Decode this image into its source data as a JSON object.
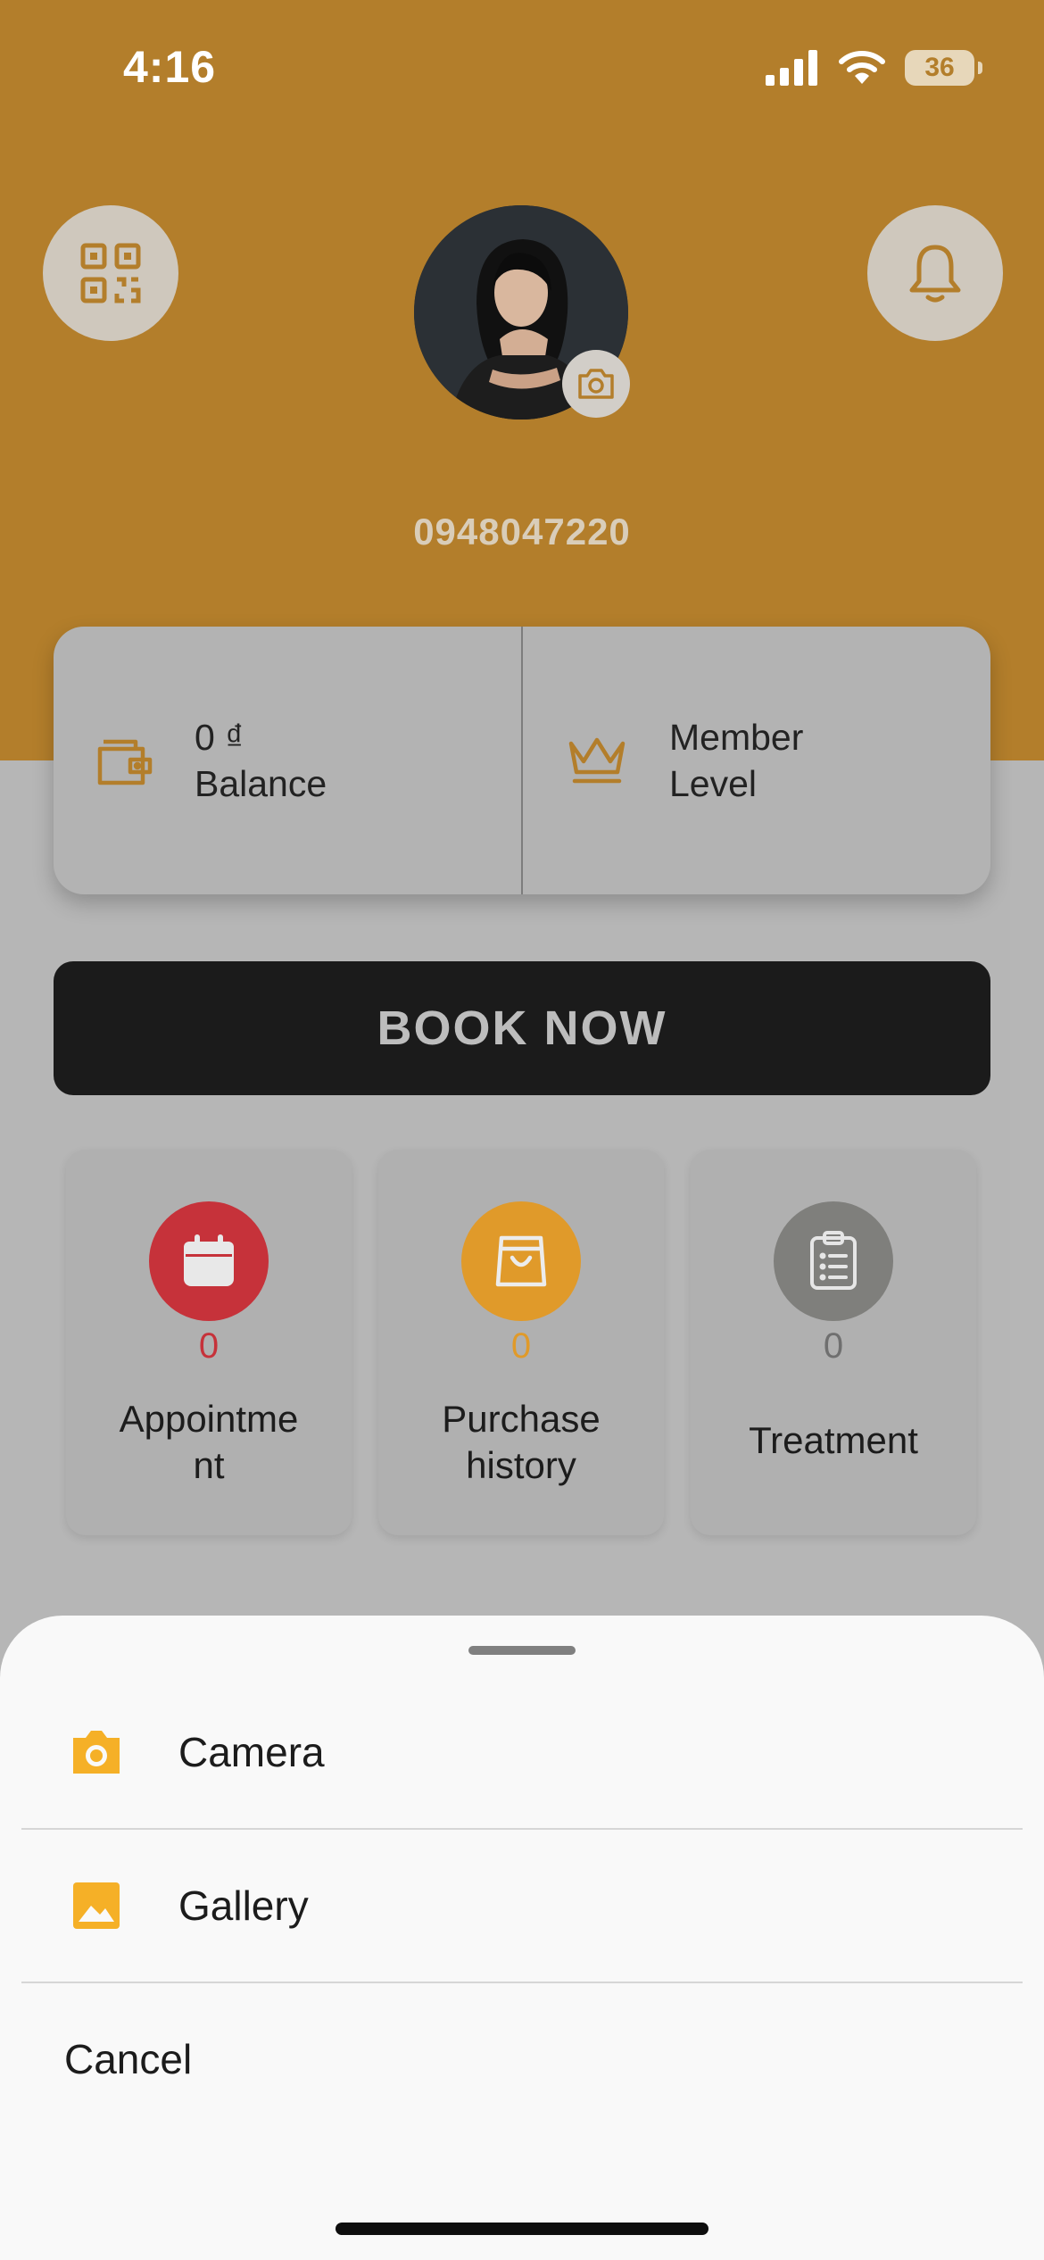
{
  "status_bar": {
    "time": "4:16",
    "battery": "36"
  },
  "profile": {
    "phone": "0948047220"
  },
  "stats": {
    "balance_value": "0 ₫",
    "balance_label": "Balance",
    "member_line1": "Member",
    "member_line2": "Level"
  },
  "book_button": "BOOK NOW",
  "tiles": [
    {
      "count": "0",
      "label_line1": "Appointme",
      "label_line2": "nt"
    },
    {
      "count": "0",
      "label_line1": "Purchase",
      "label_line2": "history"
    },
    {
      "count": "0",
      "label_line1": "Treatment"
    }
  ],
  "sheet": {
    "camera_label": "Camera",
    "gallery_label": "Gallery",
    "cancel_label": "Cancel"
  },
  "colors": {
    "header": "#b37e2b",
    "accent": "#f5b027",
    "appointment": "#c6323a",
    "purchase": "#e09a2a",
    "treatment": "#7f7f7c"
  },
  "icons": [
    "qr-code-icon",
    "bell-icon",
    "camera-icon",
    "wallet-icon",
    "crown-icon",
    "calendar-icon",
    "shopping-bag-icon",
    "clipboard-list-icon",
    "image-icon"
  ]
}
